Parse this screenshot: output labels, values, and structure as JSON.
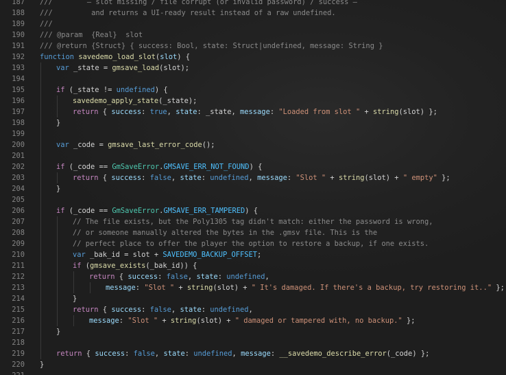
{
  "editor": {
    "indent_guides": "visible",
    "lines": [
      {
        "n": "187",
        "indent": 0,
        "tokens": [
          [
            "comment",
            "///        — slot missing / file corrupt (or invalid password) / success —"
          ]
        ]
      },
      {
        "n": "188",
        "indent": 0,
        "tokens": [
          [
            "comment",
            "///         and returns a UI-ready result instead of a raw undefined."
          ]
        ]
      },
      {
        "n": "189",
        "indent": 0,
        "tokens": [
          [
            "comment",
            "///"
          ]
        ]
      },
      {
        "n": "190",
        "indent": 0,
        "tokens": [
          [
            "comment",
            "/// @param  {Real}  slot"
          ]
        ]
      },
      {
        "n": "191",
        "indent": 0,
        "tokens": [
          [
            "comment",
            "/// @return {Struct} { success: Bool, state: Struct|undefined, message: String }"
          ]
        ]
      },
      {
        "n": "192",
        "indent": 0,
        "tokens": [
          [
            "kw2",
            "function"
          ],
          [
            "punc",
            " "
          ],
          [
            "fn",
            "savedemo_load_slot"
          ],
          [
            "punc",
            "("
          ],
          [
            "prop",
            "slot"
          ],
          [
            "punc",
            ") {"
          ]
        ]
      },
      {
        "n": "193",
        "indent": 1,
        "tokens": [
          [
            "kw2",
            "var"
          ],
          [
            "punc",
            " _state = "
          ],
          [
            "fn",
            "gmsave_load"
          ],
          [
            "punc",
            "(slot);"
          ]
        ]
      },
      {
        "n": "194",
        "indent": 1,
        "tokens": []
      },
      {
        "n": "195",
        "indent": 1,
        "tokens": [
          [
            "kw",
            "if"
          ],
          [
            "punc",
            " (_state != "
          ],
          [
            "bool",
            "undefined"
          ],
          [
            "punc",
            ") {"
          ]
        ]
      },
      {
        "n": "196",
        "indent": 2,
        "tokens": [
          [
            "fn",
            "savedemo_apply_state"
          ],
          [
            "punc",
            "(_state);"
          ]
        ]
      },
      {
        "n": "197",
        "indent": 2,
        "tokens": [
          [
            "kw",
            "return"
          ],
          [
            "punc",
            " { "
          ],
          [
            "prop",
            "success"
          ],
          [
            "punc",
            ": "
          ],
          [
            "bool",
            "true"
          ],
          [
            "punc",
            ", "
          ],
          [
            "prop",
            "state"
          ],
          [
            "punc",
            ": _state, "
          ],
          [
            "prop",
            "message"
          ],
          [
            "punc",
            ": "
          ],
          [
            "str",
            "\"Loaded from slot \""
          ],
          [
            "punc",
            " + "
          ],
          [
            "fn",
            "string"
          ],
          [
            "punc",
            "(slot) };"
          ]
        ]
      },
      {
        "n": "198",
        "indent": 1,
        "tokens": [
          [
            "punc",
            "}"
          ]
        ]
      },
      {
        "n": "199",
        "indent": 1,
        "tokens": []
      },
      {
        "n": "200",
        "indent": 1,
        "tokens": [
          [
            "kw2",
            "var"
          ],
          [
            "punc",
            " _code = "
          ],
          [
            "fn",
            "gmsave_last_error_code"
          ],
          [
            "punc",
            "();"
          ]
        ]
      },
      {
        "n": "201",
        "indent": 1,
        "tokens": []
      },
      {
        "n": "202",
        "indent": 1,
        "tokens": [
          [
            "kw",
            "if"
          ],
          [
            "punc",
            " (_code == "
          ],
          [
            "type",
            "GmSaveError"
          ],
          [
            "punc",
            "."
          ],
          [
            "const",
            "GMSAVE_ERR_NOT_FOUND"
          ],
          [
            "punc",
            ") {"
          ]
        ]
      },
      {
        "n": "203",
        "indent": 2,
        "tokens": [
          [
            "kw",
            "return"
          ],
          [
            "punc",
            " { "
          ],
          [
            "prop",
            "success"
          ],
          [
            "punc",
            ": "
          ],
          [
            "bool",
            "false"
          ],
          [
            "punc",
            ", "
          ],
          [
            "prop",
            "state"
          ],
          [
            "punc",
            ": "
          ],
          [
            "bool",
            "undefined"
          ],
          [
            "punc",
            ", "
          ],
          [
            "prop",
            "message"
          ],
          [
            "punc",
            ": "
          ],
          [
            "str",
            "\"Slot \""
          ],
          [
            "punc",
            " + "
          ],
          [
            "fn",
            "string"
          ],
          [
            "punc",
            "(slot) + "
          ],
          [
            "str",
            "\" empty\""
          ],
          [
            "punc",
            " };"
          ]
        ]
      },
      {
        "n": "204",
        "indent": 1,
        "tokens": [
          [
            "punc",
            "}"
          ]
        ]
      },
      {
        "n": "205",
        "indent": 1,
        "tokens": []
      },
      {
        "n": "206",
        "indent": 1,
        "tokens": [
          [
            "kw",
            "if"
          ],
          [
            "punc",
            " (_code == "
          ],
          [
            "type",
            "GmSaveError"
          ],
          [
            "punc",
            "."
          ],
          [
            "const",
            "GMSAVE_ERR_TAMPERED"
          ],
          [
            "punc",
            ") {"
          ]
        ]
      },
      {
        "n": "207",
        "indent": 2,
        "tokens": [
          [
            "comment",
            "// The file exists, but the Poly1305 tag didn't match: either the password is wrong,"
          ]
        ]
      },
      {
        "n": "208",
        "indent": 2,
        "tokens": [
          [
            "comment",
            "// or someone manually altered the bytes in the .gmsv file. This is the"
          ]
        ]
      },
      {
        "n": "209",
        "indent": 2,
        "tokens": [
          [
            "comment",
            "// perfect place to offer the player the option to restore a backup, if one exists."
          ]
        ]
      },
      {
        "n": "210",
        "indent": 2,
        "tokens": [
          [
            "kw2",
            "var"
          ],
          [
            "punc",
            " _bak_id = slot + "
          ],
          [
            "const",
            "SAVEDEMO_BACKUP_OFFSET"
          ],
          [
            "punc",
            ";"
          ]
        ]
      },
      {
        "n": "211",
        "indent": 2,
        "tokens": [
          [
            "kw",
            "if"
          ],
          [
            "punc",
            " ("
          ],
          [
            "fn",
            "gmsave_exists"
          ],
          [
            "punc",
            "(_bak_id)) {"
          ]
        ]
      },
      {
        "n": "212",
        "indent": 3,
        "tokens": [
          [
            "kw",
            "return"
          ],
          [
            "punc",
            " { "
          ],
          [
            "prop",
            "success"
          ],
          [
            "punc",
            ": "
          ],
          [
            "bool",
            "false"
          ],
          [
            "punc",
            ", "
          ],
          [
            "prop",
            "state"
          ],
          [
            "punc",
            ": "
          ],
          [
            "bool",
            "undefined"
          ],
          [
            "punc",
            ","
          ]
        ]
      },
      {
        "n": "213",
        "indent": 4,
        "tokens": [
          [
            "prop",
            "message"
          ],
          [
            "punc",
            ": "
          ],
          [
            "str",
            "\"Slot \""
          ],
          [
            "punc",
            " + "
          ],
          [
            "fn",
            "string"
          ],
          [
            "punc",
            "(slot) + "
          ],
          [
            "str",
            "\" It's damaged. If there's a backup, try restoring it..\""
          ],
          [
            "punc",
            " };"
          ]
        ]
      },
      {
        "n": "214",
        "indent": 2,
        "tokens": [
          [
            "punc",
            "}"
          ]
        ]
      },
      {
        "n": "215",
        "indent": 2,
        "tokens": [
          [
            "kw",
            "return"
          ],
          [
            "punc",
            " { "
          ],
          [
            "prop",
            "success"
          ],
          [
            "punc",
            ": "
          ],
          [
            "bool",
            "false"
          ],
          [
            "punc",
            ", "
          ],
          [
            "prop",
            "state"
          ],
          [
            "punc",
            ": "
          ],
          [
            "bool",
            "undefined"
          ],
          [
            "punc",
            ","
          ]
        ]
      },
      {
        "n": "216",
        "indent": 3,
        "tokens": [
          [
            "prop",
            "message"
          ],
          [
            "punc",
            ": "
          ],
          [
            "str",
            "\"Slot \""
          ],
          [
            "punc",
            " + "
          ],
          [
            "fn",
            "string"
          ],
          [
            "punc",
            "(slot) + "
          ],
          [
            "str",
            "\" damaged or tampered with, no backup.\""
          ],
          [
            "punc",
            " };"
          ]
        ]
      },
      {
        "n": "217",
        "indent": 1,
        "tokens": [
          [
            "punc",
            "}"
          ]
        ]
      },
      {
        "n": "218",
        "indent": 1,
        "tokens": []
      },
      {
        "n": "219",
        "indent": 1,
        "tokens": [
          [
            "kw",
            "return"
          ],
          [
            "punc",
            " { "
          ],
          [
            "prop",
            "success"
          ],
          [
            "punc",
            ": "
          ],
          [
            "bool",
            "false"
          ],
          [
            "punc",
            ", "
          ],
          [
            "prop",
            "state"
          ],
          [
            "punc",
            ": "
          ],
          [
            "bool",
            "undefined"
          ],
          [
            "punc",
            ", "
          ],
          [
            "prop",
            "message"
          ],
          [
            "punc",
            ": "
          ],
          [
            "fn",
            "__savedemo_describe_error"
          ],
          [
            "punc",
            "(_code) };"
          ]
        ]
      },
      {
        "n": "220",
        "indent": 0,
        "tokens": [
          [
            "punc",
            "}"
          ]
        ]
      },
      {
        "n": "221",
        "indent": 0,
        "tokens": []
      }
    ]
  }
}
